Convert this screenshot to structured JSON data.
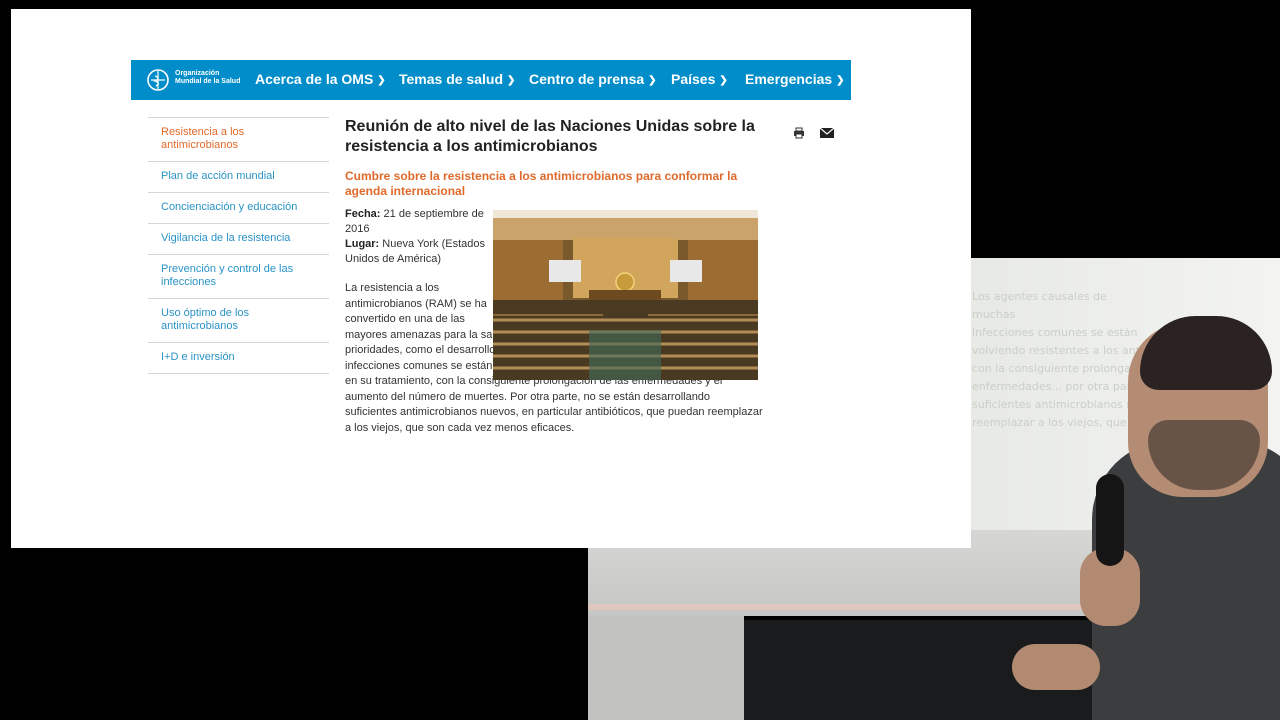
{
  "nav": {
    "logo_line1": "Organización",
    "logo_line2": "Mundial de la Salud",
    "items": [
      "Acerca de la OMS",
      "Temas de salud",
      "Centro de prensa",
      "Países",
      "Emergencias"
    ]
  },
  "sidebar": {
    "items": [
      "Resistencia a los antimicrobianos",
      "Plan de acción mundial",
      "Concienciación y educación",
      "Vigilancia de la resistencia",
      "Prevención y control de las infecciones",
      "Uso óptimo de los antimicrobianos",
      "I+D e inversión"
    ]
  },
  "article": {
    "title": "Reunión de alto nivel de las Naciones Unidas sobre la resistencia a los antimicrobianos",
    "subtitle": "Cumbre sobre la resistencia a los antimicrobianos para conformar la agenda internacional",
    "date_label": "Fecha:",
    "date_value": "21 de septiembre de 2016",
    "place_label": "Lugar:",
    "place_value": "Nueva York (Estados Unidos de América)",
    "body": "La resistencia a los antimicrobianos (RAM) se ha convertido en una de las mayores amenazas para la salud mundial y pone en peligro otras importantes prioridades, como el desarrollo humano. Los agentes causales de muchas infecciones comunes se están volviendo resistentes a los antimicrobianos utilizados en su tratamiento, con la consiguiente prolongación de las enfermedades y el aumento del número de muertes. Por otra parte, no se están desarrollando suficientes antimicrobianos nuevos, en particular antibióticos, que puedan reemplazar a los viejos, que son cada vez menos eficaces."
  },
  "icons": {
    "print": "print-icon",
    "email": "email-icon"
  },
  "colors": {
    "nav_bg": "#008dc9",
    "accent_orange": "#e06a2b",
    "link_blue": "#2a93c6"
  },
  "projection": {
    "lines": [
      "Los agentes causales de muchas",
      "infecciones comunes se están",
      "volviendo resistentes a los antimicrobianos",
      "con la consiguiente prolongación de las",
      "enfermedades... por otra parte, no se están desarrollando",
      "suficientes antimicrobianos nuevos, en particular antibióticos, que puedan",
      "reemplazar a los viejos, que son cada vez menos eficaces."
    ]
  }
}
